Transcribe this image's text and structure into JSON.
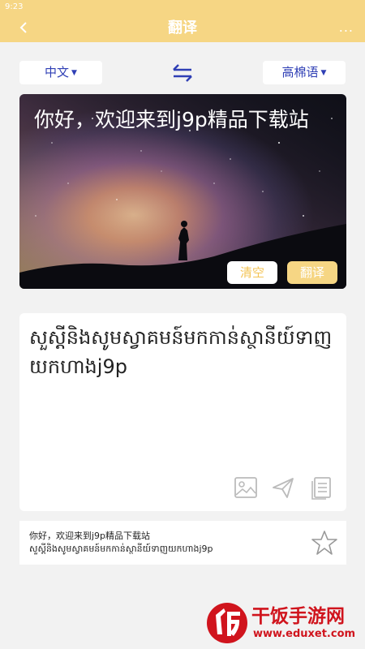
{
  "status_bar": {
    "time": "9:23"
  },
  "app_bar": {
    "title": "翻译",
    "back_icon": "back-arrow-icon",
    "more_icon": "more-dots-icon",
    "more_label": "..."
  },
  "languages": {
    "source": "中文",
    "target": "高棉语",
    "swap_icon": "swap-arrows-icon"
  },
  "input": {
    "text": "你好，欢迎来到j9p精品下载站",
    "clear_label": "清空",
    "translate_label": "翻译"
  },
  "result": {
    "text": "សួស្ដីនិងសូមស្វាគមន៍មកកាន់ស្ថានីយ៍ទាញយកហាងj9p",
    "actions": [
      "image-icon",
      "send-icon",
      "copy-icon"
    ]
  },
  "history": {
    "source": "你好，欢迎来到j9p精品下载站",
    "translation": "សួស្ដីនិងសូមស្វាគមន៍មកកាន់ស្ថានីយ៍ទាញយកហាងj9p",
    "favorite_icon": "star-outline-icon"
  },
  "watermark": {
    "name": "干饭手游网",
    "url": "www.eduxet.com"
  },
  "colors": {
    "accent": "#f6d684",
    "link": "#2f3fb5",
    "brand_red": "#d0141d"
  }
}
